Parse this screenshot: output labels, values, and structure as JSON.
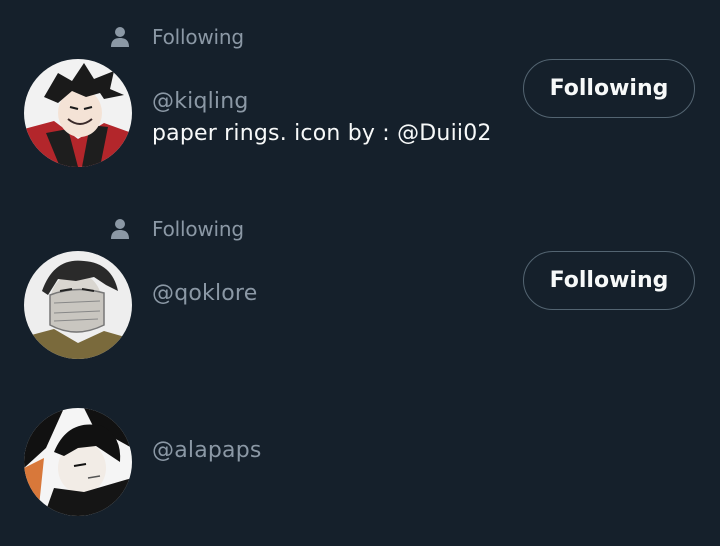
{
  "users": [
    {
      "context": "Following",
      "context_icon": "person-icon",
      "handle": "@kiqling",
      "bio": "paper rings. icon by : @Duii02",
      "button_label": "Following",
      "avatar_colors": {
        "bg": "#f2f2f2",
        "shirt": "#b3262b",
        "hair": "#1a1a1a"
      }
    },
    {
      "context": "Following",
      "context_icon": "person-icon",
      "handle": "@qoklore",
      "bio": "",
      "button_label": "Following",
      "avatar_colors": {
        "bg": "#eeeeee",
        "coat": "#7a6a3c",
        "hair": "#2a2a2a"
      }
    },
    {
      "handle": "@alapaps",
      "avatar_colors": {
        "bg": "#f5f5f5",
        "hair": "#111111",
        "accent": "#d8783a"
      }
    }
  ],
  "colors": {
    "background": "#15202b",
    "secondary_text": "#8b98a5",
    "primary_text": "#f7f9f9",
    "button_border": "#536471"
  }
}
